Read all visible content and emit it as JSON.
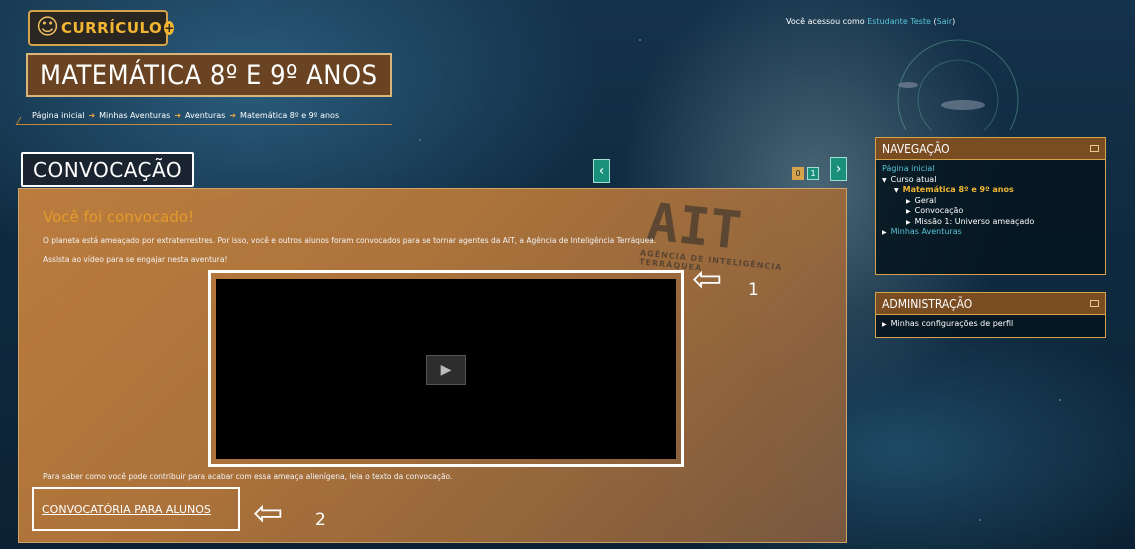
{
  "header": {
    "logo_text": "CURRÍCULO",
    "course_title": "MATEMÁTICA 8º E 9º ANOS",
    "user_info_prefix": "Você acessou como ",
    "user_name": "Estudante Teste",
    "logout_label": "Sair"
  },
  "breadcrumb": [
    "Página inicial",
    "Minhas Aventuras",
    "Aventuras",
    "Matemática 8º e 9º anos"
  ],
  "section": {
    "title": "CONVOCAÇÃO",
    "prev_label": "‹",
    "next_label": "›",
    "pages": [
      "0",
      "1"
    ]
  },
  "main": {
    "heading": "Você foi convocado!",
    "paragraph1": "O planeta está ameaçado por extraterrestres. Por isso, você e outros alunos foram convocados para se tornar agentes da AIT, a Agência de Inteligência Terráquea.",
    "paragraph2": "Assista ao vídeo para se engajar nesta aventura!",
    "stamp_text": "AIT",
    "stamp_subtext": "AGÊNCIA DE INTELIGÊNCIA TERRÁQUEA",
    "paragraph3": "Para saber como você pode contribuir para acabar com essa ameaça alienígena, leia o texto da convocação.",
    "link_label": "CONVOCATÓRIA PARA ALUNOS",
    "annotation_1": "1",
    "annotation_2": "2"
  },
  "navigation": {
    "title": "NAVEGAÇÃO",
    "items": {
      "home": "Página inicial",
      "current_course": "Curso atual",
      "course": "Matemática 8º e 9º anos",
      "geral": "Geral",
      "convocacao": "Convocação",
      "missao1": "Missão 1: Universo ameaçado",
      "minhas_aventuras": "Minhas Aventuras"
    }
  },
  "administration": {
    "title": "ADMINISTRAÇÃO",
    "items": {
      "profile_settings": "Minhas configurações de perfil"
    }
  },
  "colors": {
    "accent_orange": "#f2b632",
    "link_cyan": "#57c4d8",
    "panel_brown": "#7a4c22",
    "nav_teal": "#1a8f7a"
  }
}
